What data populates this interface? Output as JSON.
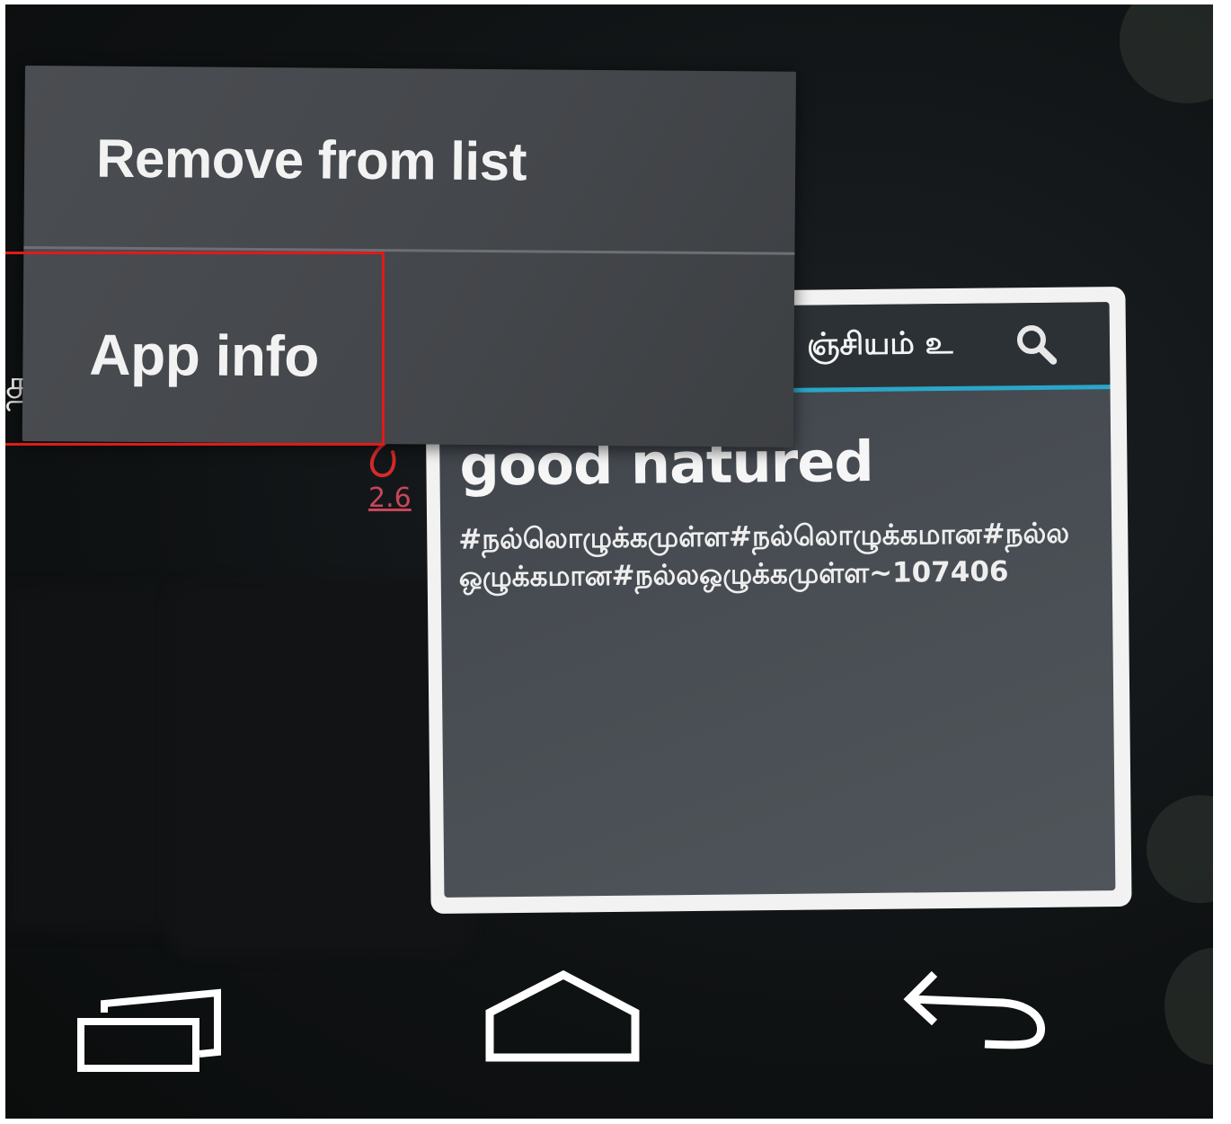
{
  "popup_menu": {
    "items": [
      {
        "label": "Remove from list"
      },
      {
        "label": "App info"
      }
    ]
  },
  "app_card": {
    "actionbar_title": "ஞ்சியம் உ",
    "heading": "good natured",
    "body": "#நல்லொழுக்கமுள்ள#நல்லொழுக்கமான#நல்லஒழுக்கமான#நல்லஒழுக்கமுள்ள~107406"
  },
  "background": {
    "left_peek_glyph": "த",
    "annotation_number": "2.6"
  },
  "colors": {
    "highlight": "#e01a1a",
    "accent": "#2aa6c8"
  },
  "icons": {
    "search": "search-icon",
    "recents": "recent-apps-icon",
    "home": "home-icon",
    "back": "back-icon"
  }
}
